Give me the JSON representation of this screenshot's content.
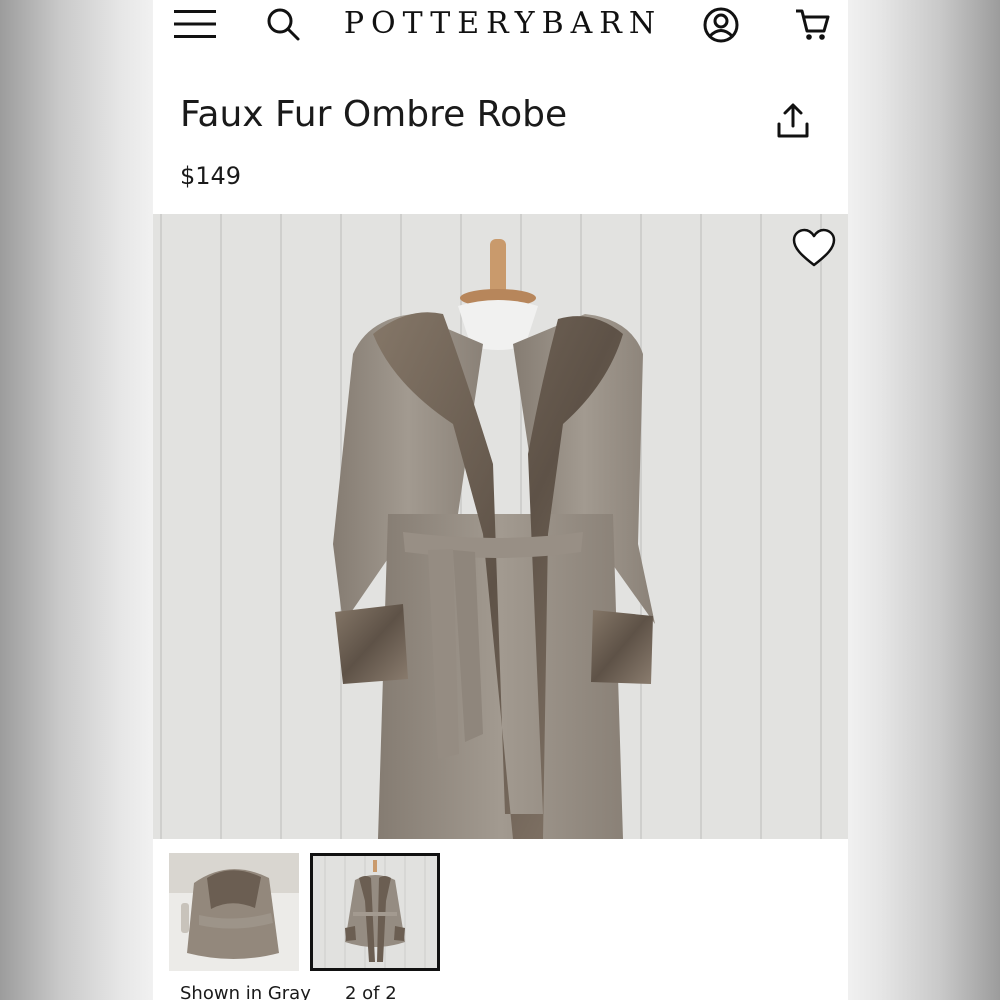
{
  "header": {
    "brand": "POTTERYBARN",
    "icons": {
      "menu": "hamburger-menu-icon",
      "search": "search-icon",
      "account": "account-icon",
      "cart": "cart-icon"
    }
  },
  "product": {
    "title": "Faux Fur Ombre Robe",
    "price": "$149",
    "share_icon": "share-icon",
    "favorite_icon": "heart-icon"
  },
  "gallery": {
    "caption_color": "Shown in Gray",
    "caption_count": "2 of 2",
    "thumbnails": [
      {
        "selected": false
      },
      {
        "selected": true
      }
    ]
  },
  "colors": {
    "text": "#1a1a1a",
    "page_background": "#ffffff",
    "selected_border": "#111111",
    "robe": "#8e857b",
    "fur": "#6f6256"
  }
}
